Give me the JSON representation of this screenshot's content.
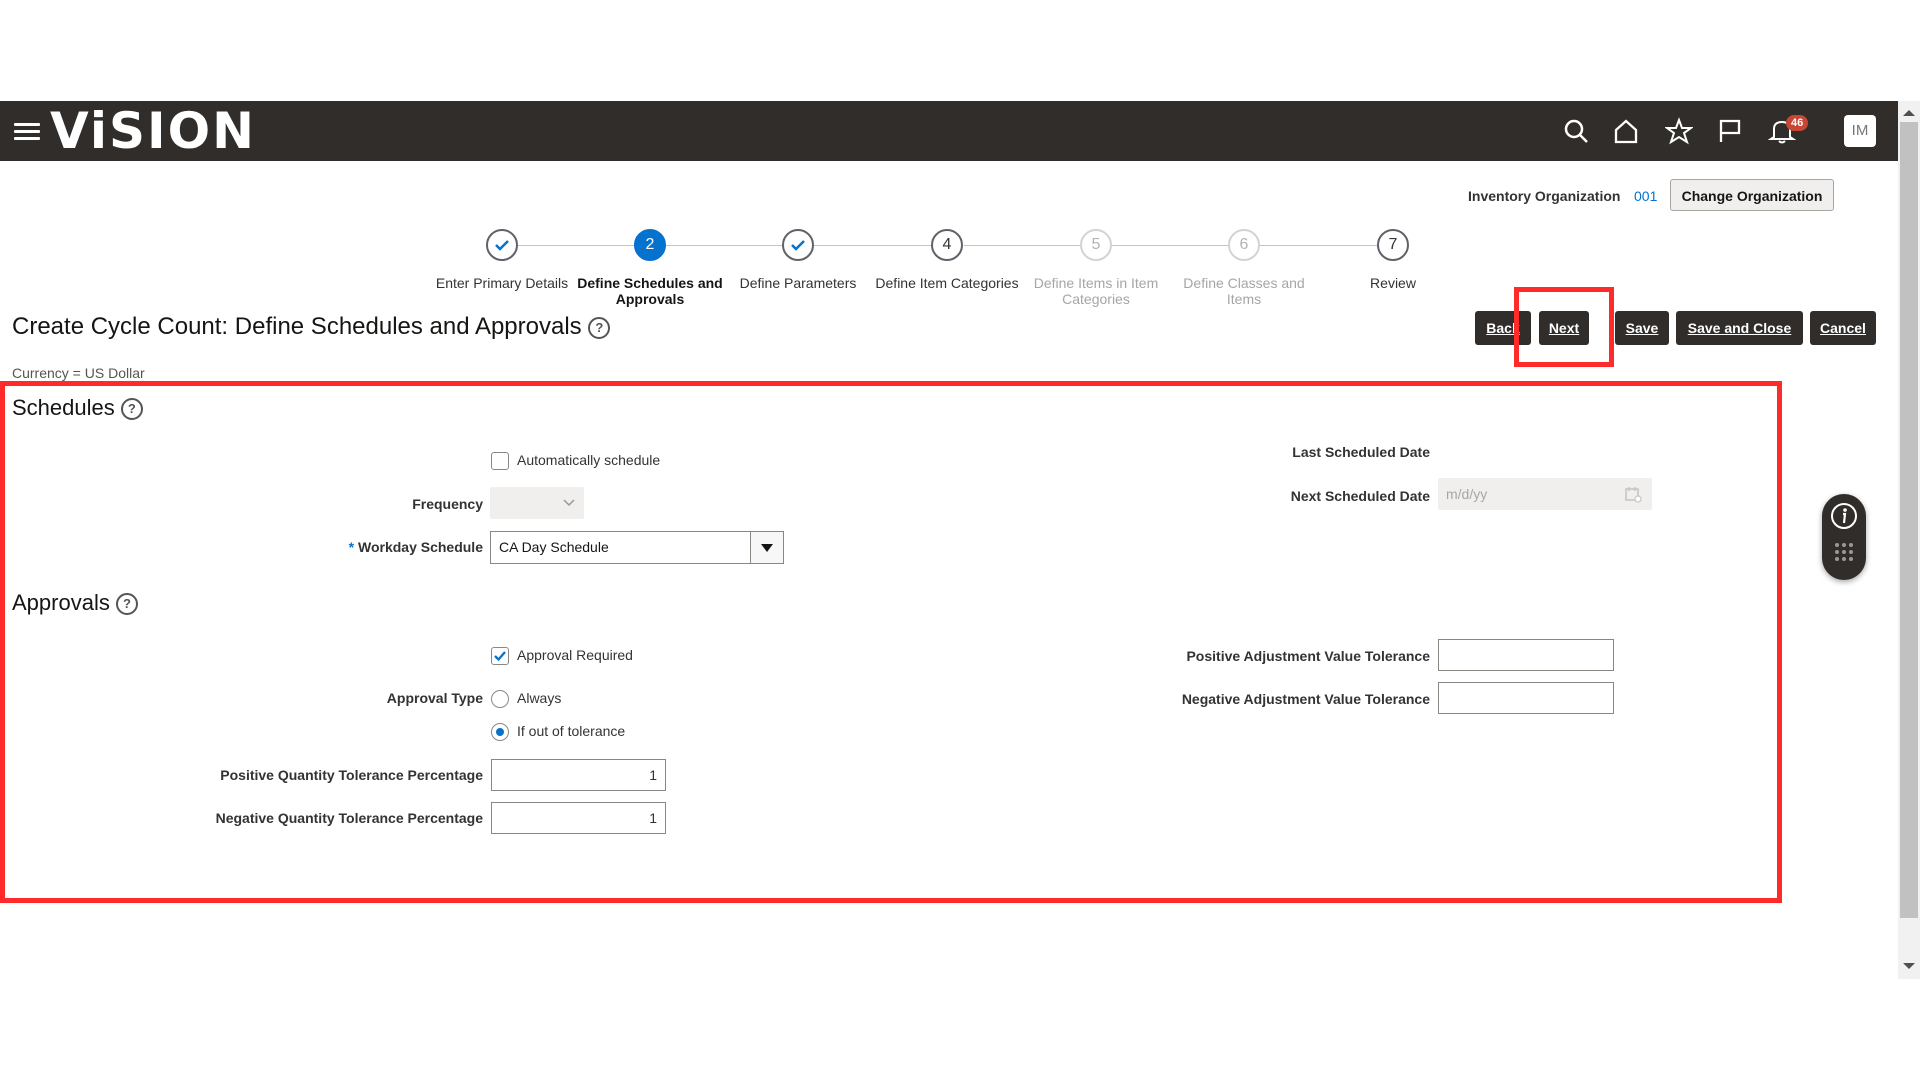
{
  "app": {
    "logo": "ViSION",
    "notifications_count": "46",
    "user_initials": "IM"
  },
  "icons": {
    "menu": "hamburger-icon",
    "search": "search-icon",
    "home": "home-icon",
    "favorites": "star-icon",
    "flag": "flag-icon",
    "bell": "bell-icon"
  },
  "organization": {
    "label": "Inventory Organization",
    "value": "001",
    "change_button": "Change Organization"
  },
  "train": [
    {
      "label": "Enter Primary Details",
      "state": "done",
      "num": ""
    },
    {
      "label": "Define Schedules and Approvals",
      "state": "current",
      "num": "2"
    },
    {
      "label": "Define Parameters",
      "state": "done",
      "num": ""
    },
    {
      "label": "Define Item Categories",
      "state": "todo",
      "num": "4"
    },
    {
      "label": "Define Items in Item Categories",
      "state": "disabled",
      "num": "5"
    },
    {
      "label": "Define Classes and Items",
      "state": "disabled",
      "num": "6"
    },
    {
      "label": "Review",
      "state": "todo",
      "num": "7"
    }
  ],
  "page": {
    "title": "Create Cycle Count: Define Schedules and Approvals",
    "currency": "Currency = US Dollar"
  },
  "buttons": {
    "back": "Back",
    "next": "Next",
    "save": "Save",
    "save_close": "Save and Close",
    "cancel": "Cancel"
  },
  "schedules": {
    "title": "Schedules",
    "auto_schedule": "Automatically schedule",
    "auto_schedule_checked": false,
    "frequency_label": "Frequency",
    "workday_label": "Workday Schedule",
    "workday_value": "CA Day Schedule",
    "last_date_label": "Last Scheduled Date",
    "next_date_label": "Next Scheduled Date",
    "next_date_placeholder": "m/d/yy"
  },
  "approvals": {
    "title": "Approvals",
    "approval_required": "Approval Required",
    "approval_required_checked": true,
    "approval_type_label": "Approval Type",
    "type_always": "Always",
    "type_out_of_tolerance": "If out of tolerance",
    "selected_type": "If out of tolerance",
    "pos_qty_label": "Positive Quantity Tolerance Percentage",
    "pos_qty_value": "1",
    "neg_qty_label": "Negative Quantity Tolerance Percentage",
    "neg_qty_value": "1",
    "pos_adj_label": "Positive Adjustment Value Tolerance",
    "pos_adj_value": "",
    "neg_adj_label": "Negative Adjustment Value Tolerance",
    "neg_adj_value": ""
  },
  "colors": {
    "header_bg": "#312d2a",
    "accent": "#0572ce",
    "highlight": "#ff2a2a",
    "badge": "#c74634"
  }
}
